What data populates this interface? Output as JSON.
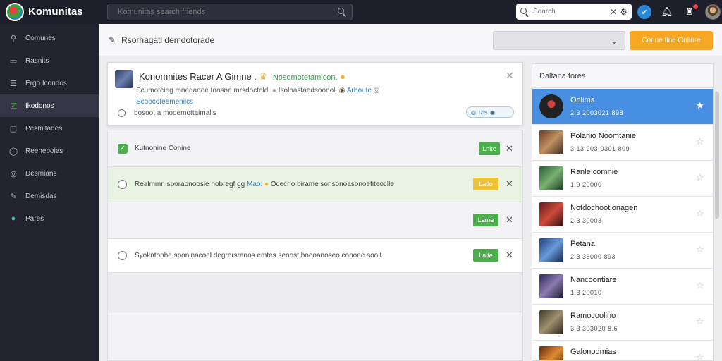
{
  "app": {
    "name": "Komunitas",
    "tagline": ""
  },
  "top_search": {
    "placeholder": "Komunitas search friends"
  },
  "user_search": {
    "value": "Search"
  },
  "sidebar": {
    "items": [
      {
        "label": "Comunes",
        "icon": "user-icon"
      },
      {
        "label": "Rasnits",
        "icon": "box-icon"
      },
      {
        "label": "Ergo Icondos",
        "icon": "list-icon"
      },
      {
        "label": "Ikodonos",
        "icon": "check-square-icon",
        "active": true
      },
      {
        "label": "Pesmitades",
        "icon": "folder-icon"
      },
      {
        "label": "Reenebolas",
        "icon": "circle-icon"
      },
      {
        "label": "Desmians",
        "icon": "circle-icon"
      },
      {
        "label": "Demisdas",
        "icon": "wrench-icon"
      },
      {
        "label": "Pares",
        "icon": "globe-icon"
      }
    ]
  },
  "subheader": {
    "title": "Rsorhagatl demdotorade",
    "select_value": "",
    "online_button": "Conne fine Onlinre"
  },
  "card": {
    "title": "Konomnites Racer A Gimne .",
    "highlight": "Nosomotetamicon.",
    "desc_text": "Scumoteing mnedaooe toosne mrsdocteld.",
    "desc_link_text": "Isolnastaedsoonol.",
    "desc_link2": "Arboute",
    "link": "Scoocofeemeniics",
    "footer": "bosoot a mooemottaimalis",
    "chip": "tzis"
  },
  "list": {
    "header_title": "Kutnonine Conine",
    "rows": [
      {
        "type": "radio",
        "text": "Realmmn sporaonoosie hobregf gg",
        "highlight": "Mao:",
        "tail": "Ocecrio birame sonsonoasonoefiteoclle",
        "pill": "Latlo",
        "pill_color": "yellow"
      },
      {
        "type": "empty",
        "text": "",
        "pill": "Lame",
        "pill_color": "green"
      },
      {
        "type": "radio",
        "text": "Syokntonhe sponinacoel degrersranos emtes seoost boooanoseo conoee sooit.",
        "pill": "Lalte",
        "pill_color": "green"
      }
    ],
    "header_pill": "Lnite"
  },
  "rpanel": {
    "title": "Daltana fores",
    "items": [
      {
        "name": "Onlims",
        "meta": "2.3 2003021 898",
        "active": true
      },
      {
        "name": "Polanio Noomtanie",
        "meta": "3.13 203-0301 809"
      },
      {
        "name": "Ranle comnie",
        "meta": "1.9 20000"
      },
      {
        "name": "Notdochootionagen",
        "meta": "2.3 30003"
      },
      {
        "name": "Petana",
        "meta": "2.3 36000 893"
      },
      {
        "name": "Nancoontiare",
        "meta": "1.3 20010"
      },
      {
        "name": "Ramocoolino",
        "meta": "3.3 303020 8.6"
      },
      {
        "name": "Galonodmias",
        "meta": ""
      }
    ]
  },
  "colors": {
    "accent": "#4a90e2",
    "orange": "#f5a623",
    "green": "#4cae4c",
    "sidebar": "#23242f"
  }
}
